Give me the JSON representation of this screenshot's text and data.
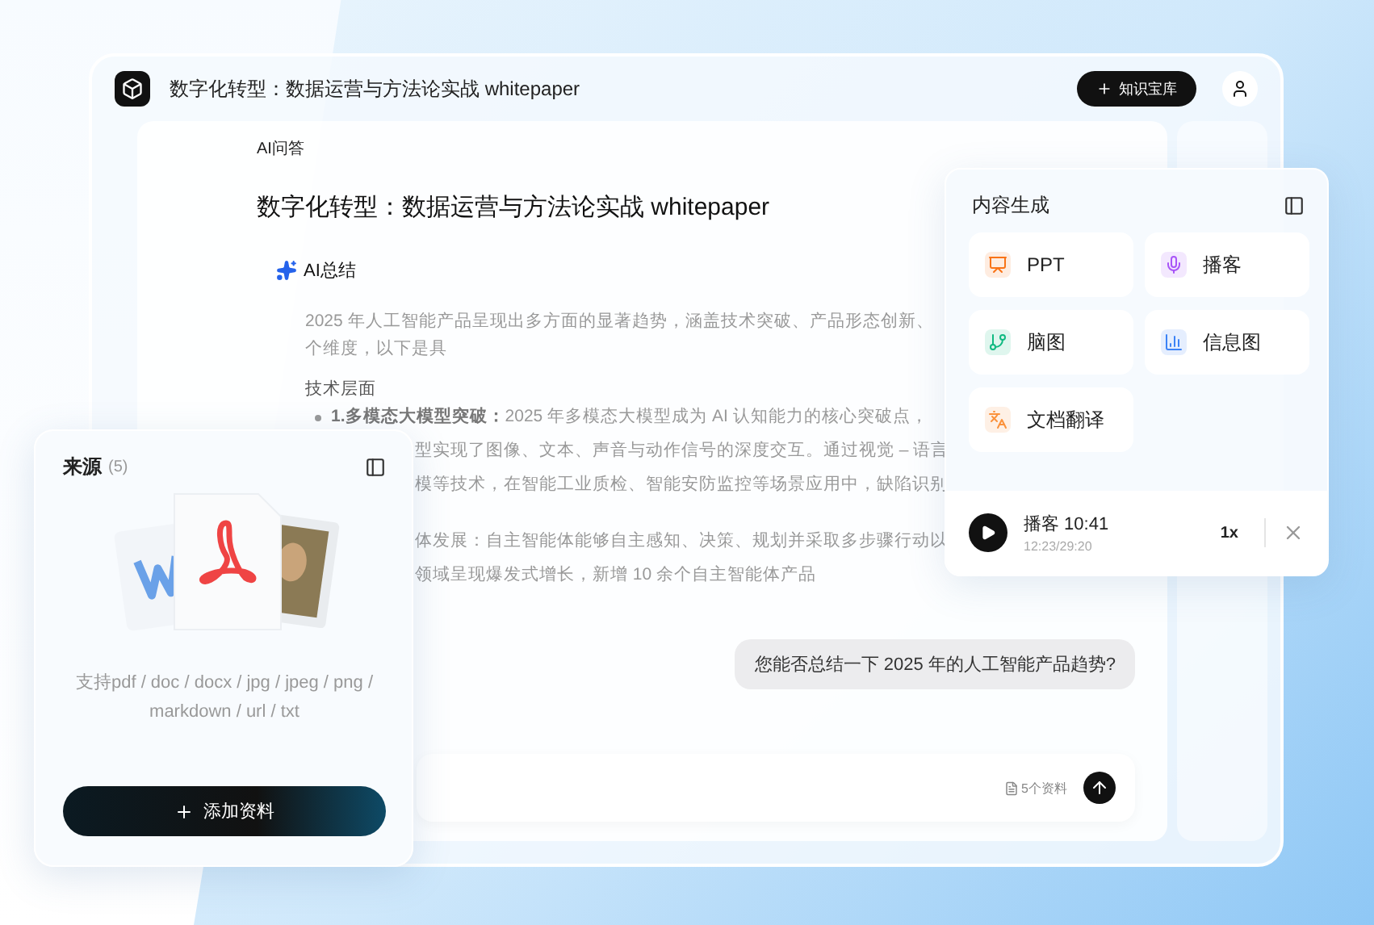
{
  "header": {
    "title": "数字化转型：数据运营与方法论实战 whitepaper",
    "library_button": "知识宝库"
  },
  "qa": {
    "label": "AI问答",
    "heading": "数字化转型：数据运营与方法论实战 whitepaper",
    "summary_label": "AI总结",
    "lines": [
      {
        "kind": "text",
        "text": "2025 年人工智能产品呈现出多方面的显著趋势，涵盖技术突破、产品形态创新、"
      },
      {
        "kind": "text",
        "text": "个维度，以下是具"
      },
      {
        "kind": "subheading",
        "text": "技术层面"
      },
      {
        "kind": "bullet",
        "text": "**1.多模态大模型突破：**2025 年多模态大模型成为 AI 认知能力的核心突破点，"
      },
      {
        "kind": "continuation",
        "text": "型实现了图像、文本、声音与动作信号的深度交互。通过视觉 – 语言"
      },
      {
        "kind": "continuation",
        "text": "模等技术，在智能工业质检、智能安防监控等场景应用中，缺陷识别"
      },
      {
        "kind": "gap_continuation",
        "text": "体发展：自主智能体能够自主感知、决策、规划并采取多步骤行动以"
      },
      {
        "kind": "continuation",
        "text": "领域呈现爆发式增长，新增 10 余个自主智能体产品"
      }
    ]
  },
  "chat": {
    "question": "您能否总结一下 2025 年的人工智能产品趋势?",
    "sources": "5个资料"
  },
  "content_panel": {
    "title": "内容生成",
    "tools": [
      {
        "kind": "ppt",
        "label": "PPT",
        "color": "#f97316"
      },
      {
        "kind": "podcast",
        "label": "播客",
        "color": "#a855f7"
      },
      {
        "kind": "mindmap",
        "label": "脑图",
        "color": "#10b981"
      },
      {
        "kind": "infographic",
        "label": "信息图",
        "color": "#3b82f6"
      },
      {
        "kind": "translate",
        "label": "文档翻译",
        "color": "#fb923c"
      }
    ],
    "player": {
      "title": "播客 10:41",
      "time": "12:23/29:20",
      "speed": "1x"
    }
  },
  "sources_panel": {
    "title": "来源",
    "count": "(5)",
    "formats": "支持pdf / doc / docx / jpg / jpeg / png / markdown / url / txt",
    "add_button": "添加资料"
  }
}
